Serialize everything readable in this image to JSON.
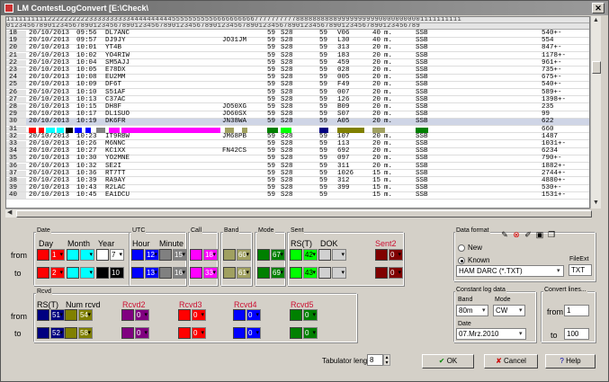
{
  "window": {
    "title": "LM ContestLogConvert [E:\\Check\\"
  },
  "grid": {
    "header_top": "11111111112222222222333333333344444444445555555555666666666677777777778888888888999999999900000000001111111111",
    "header_bottom": "0123456789012345678901234567890123456789012345678901234567890123456789012345678901234567890123456789",
    "rows": [
      {
        "n": "18",
        "date": "20/10/2013",
        "time": "09:56",
        "call": "DL7ANC",
        "loc": "",
        "rst": "59",
        "s": "S28",
        "rs": "59",
        "rn": "V06",
        "band": "40",
        "m": "m.",
        "mode": "SSB",
        "pts": "540+-"
      },
      {
        "n": "19",
        "date": "20/10/2013",
        "time": "09:57",
        "call": "DJ9JY",
        "loc": "JO31JM",
        "rst": "59",
        "s": "S28",
        "rs": "59",
        "rn": "L30",
        "band": "40",
        "m": "m.",
        "mode": "SSB",
        "pts": "554"
      },
      {
        "n": "20",
        "date": "20/10/2013",
        "time": "10:01",
        "call": "YT4B",
        "loc": "",
        "rst": "59",
        "s": "S28",
        "rs": "59",
        "rn": "313",
        "band": "20",
        "m": "m.",
        "mode": "SSB",
        "pts": "847+-"
      },
      {
        "n": "21",
        "date": "20/10/2013",
        "time": "10:02",
        "call": "YO4RIW",
        "loc": "",
        "rst": "59",
        "s": "S28",
        "rs": "59",
        "rn": "183",
        "band": "20",
        "m": "m.",
        "mode": "SSB",
        "pts": "1178+-"
      },
      {
        "n": "22",
        "date": "20/10/2013",
        "time": "10:04",
        "call": "SM5AJJ",
        "loc": "",
        "rst": "59",
        "s": "S28",
        "rs": "59",
        "rn": "459",
        "band": "20",
        "m": "m.",
        "mode": "SSB",
        "pts": "961+-"
      },
      {
        "n": "23",
        "date": "20/10/2013",
        "time": "10:05",
        "call": "E78DX",
        "loc": "",
        "rst": "59",
        "s": "S28",
        "rs": "59",
        "rn": "028",
        "band": "20",
        "m": "m.",
        "mode": "SSB",
        "pts": "735+-"
      },
      {
        "n": "24",
        "date": "20/10/2013",
        "time": "10:08",
        "call": "EU2MM",
        "loc": "",
        "rst": "59",
        "s": "S28",
        "rs": "59",
        "rn": "005",
        "band": "20",
        "m": "m.",
        "mode": "SSB",
        "pts": "675+-"
      },
      {
        "n": "25",
        "date": "20/10/2013",
        "time": "10:09",
        "call": "DF6T",
        "loc": "",
        "rst": "59",
        "s": "S28",
        "rs": "59",
        "rn": "F49",
        "band": "20",
        "m": "m.",
        "mode": "SSB",
        "pts": "540+-"
      },
      {
        "n": "26",
        "date": "20/10/2013",
        "time": "10:10",
        "call": "S51AF",
        "loc": "",
        "rst": "59",
        "s": "S28",
        "rs": "59",
        "rn": "007",
        "band": "20",
        "m": "m.",
        "mode": "SSB",
        "pts": "589+-"
      },
      {
        "n": "27",
        "date": "20/10/2013",
        "time": "10:13",
        "call": "C37AC",
        "loc": "",
        "rst": "59",
        "s": "S28",
        "rs": "59",
        "rn": "126",
        "band": "20",
        "m": "m.",
        "mode": "SSB",
        "pts": "1398+-"
      },
      {
        "n": "28",
        "date": "20/10/2013",
        "time": "10:15",
        "call": "DH8F",
        "loc": "JO50XG",
        "rst": "59",
        "s": "S28",
        "rs": "59",
        "rn": "B09",
        "band": "20",
        "m": "m.",
        "mode": "SSB",
        "pts": "235"
      },
      {
        "n": "29",
        "date": "20/10/2013",
        "time": "10:17",
        "call": "DL1SUO",
        "loc": "JO60SX",
        "rst": "59",
        "s": "S28",
        "rs": "59",
        "rn": "S07",
        "band": "20",
        "m": "m.",
        "mode": "SSB",
        "pts": "99"
      },
      {
        "n": "30",
        "date": "20/10/2013",
        "time": "10:19",
        "call": "DK6FR",
        "loc": "JN38WA",
        "rst": "59",
        "s": "S28",
        "rs": "59",
        "rn": "A05",
        "band": "20",
        "m": "m.",
        "mode": "SSB",
        "pts": "622"
      },
      {
        "n": "31",
        "date": "",
        "time": "",
        "call": "",
        "loc": "",
        "rst": "",
        "s": "",
        "rs": "",
        "rn": "",
        "band": "",
        "m": "",
        "mode": "",
        "pts": "660"
      },
      {
        "n": "32",
        "date": "20/10/2013",
        "time": "10:23",
        "call": "IT9RBW",
        "loc": "JM68PB",
        "rst": "59",
        "s": "S28",
        "rs": "59",
        "rn": "107",
        "band": "20",
        "m": "m.",
        "mode": "SSB",
        "pts": "1487"
      },
      {
        "n": "33",
        "date": "20/10/2013",
        "time": "10:26",
        "call": "M6NNC",
        "loc": "",
        "rst": "59",
        "s": "S28",
        "rs": "59",
        "rn": "113",
        "band": "20",
        "m": "m.",
        "mode": "SSB",
        "pts": "1031+-"
      },
      {
        "n": "34",
        "date": "20/10/2013",
        "time": "10:27",
        "call": "KC1XX",
        "loc": "FN42CS",
        "rst": "59",
        "s": "S28",
        "rs": "59",
        "rn": "692",
        "band": "20",
        "m": "m.",
        "mode": "SSB",
        "pts": "6234"
      },
      {
        "n": "35",
        "date": "20/10/2013",
        "time": "10:30",
        "call": "YO2MNE",
        "loc": "",
        "rst": "59",
        "s": "S28",
        "rs": "59",
        "rn": "097",
        "band": "20",
        "m": "m.",
        "mode": "SSB",
        "pts": "790+-"
      },
      {
        "n": "36",
        "date": "20/10/2013",
        "time": "10:32",
        "call": "SE2I",
        "loc": "",
        "rst": "59",
        "s": "S28",
        "rs": "59",
        "rn": "311",
        "band": "20",
        "m": "m.",
        "mode": "SSB",
        "pts": "1882+-"
      },
      {
        "n": "37",
        "date": "20/10/2013",
        "time": "10:36",
        "call": "RT7TT",
        "loc": "",
        "rst": "59",
        "s": "S28",
        "rs": "59",
        "rn": "1026",
        "band": "15",
        "m": "m.",
        "mode": "SSB",
        "pts": "2744+-"
      },
      {
        "n": "38",
        "date": "20/10/2013",
        "time": "10:39",
        "call": "RA9AY",
        "loc": "",
        "rst": "59",
        "s": "S28",
        "rs": "59",
        "rn": "312",
        "band": "15",
        "m": "m.",
        "mode": "SSB",
        "pts": "4880+-"
      },
      {
        "n": "39",
        "date": "20/10/2013",
        "time": "10:43",
        "call": "R2LAC",
        "loc": "",
        "rst": "59",
        "s": "S28",
        "rs": "59",
        "rn": "399",
        "band": "15",
        "m": "m.",
        "mode": "SSB",
        "pts": "530+-"
      },
      {
        "n": "40",
        "date": "20/10/2013",
        "time": "10:45",
        "call": "EA1DCU",
        "loc": "",
        "rst": "59",
        "s": "S28",
        "rs": "59",
        "rn": "",
        "band": "15",
        "m": "m.",
        "mode": "SSB",
        "pts": "1531+-"
      }
    ]
  },
  "sections": {
    "from": "from",
    "to": "to",
    "date": {
      "label": "Date",
      "day": "Day",
      "month": "Month",
      "year": "Year",
      "from": [
        {
          "v": "1",
          "c": "#ff0000"
        },
        {
          "v": "",
          "c": "#00ffff"
        },
        {
          "v": "7",
          "c": "#ffffff"
        }
      ],
      "to": [
        {
          "v": "2",
          "c": "#ff0000"
        },
        {
          "v": "",
          "c": "#00ffff"
        },
        {
          "v": "10",
          "c": "#000000"
        }
      ]
    },
    "utc": {
      "label": "UTC",
      "hour": "Hour",
      "minute": "Minute",
      "from": [
        {
          "v": "12",
          "c": "#0000ff"
        },
        {
          "v": "15",
          "c": "#808080"
        }
      ],
      "to": [
        {
          "v": "13",
          "c": "#0000ff"
        },
        {
          "v": "16",
          "c": "#808080"
        }
      ]
    },
    "call": {
      "label": "Call",
      "from": {
        "v": "18",
        "c": "#ff00ff"
      },
      "to": {
        "v": "33",
        "c": "#ff00ff"
      }
    },
    "band": {
      "label": "Band",
      "from": {
        "v": "60",
        "c": "#a0a060"
      },
      "to": {
        "v": "61",
        "c": "#a0a060"
      }
    },
    "mode": {
      "label": "Mode",
      "from": {
        "v": "67",
        "c": "#008000"
      },
      "to": {
        "v": "69",
        "c": "#008000"
      }
    },
    "sent": {
      "label": "Sent",
      "rst": "RS(T)",
      "dok": "DOK",
      "sent2": "Sent2",
      "from": [
        {
          "v": "42",
          "c": "#00ff00"
        },
        {
          "v": "",
          "c": "#d0d0d0"
        },
        {
          "v": "0",
          "c": "#800000"
        }
      ],
      "to": [
        {
          "v": "43",
          "c": "#00ff00"
        },
        {
          "v": "",
          "c": "#d0d0d0"
        },
        {
          "v": "0",
          "c": "#800000"
        }
      ]
    },
    "rcvd": {
      "label": "Rcvd",
      "rst": "RS(T)",
      "num": "Num rcvd",
      "r2": "Rcvd2",
      "r3": "Rcvd3",
      "r4": "Rcvd4",
      "r5": "Rcvd5",
      "from": [
        {
          "v": "51",
          "c": "#000080"
        },
        {
          "v": "54",
          "c": "#808000"
        },
        {
          "v": "0",
          "c": "#800080"
        },
        {
          "v": "0",
          "c": "#ff0000"
        },
        {
          "v": "0",
          "c": "#0000ff"
        },
        {
          "v": "0",
          "c": "#008000"
        }
      ],
      "to": [
        {
          "v": "52",
          "c": "#000080"
        },
        {
          "v": "58",
          "c": "#808000"
        },
        {
          "v": "0",
          "c": "#800080"
        },
        {
          "v": "0",
          "c": "#ff0000"
        },
        {
          "v": "0",
          "c": "#0000ff"
        },
        {
          "v": "0",
          "c": "#008000"
        }
      ]
    },
    "tab": {
      "label": "Tabulator length",
      "value": "8"
    }
  },
  "dataformat": {
    "label": "Data format",
    "new": "New",
    "known": "Known",
    "select": "HAM DARC (*.TXT)",
    "fileext_label": "FileExt",
    "fileext": "TXT"
  },
  "constant": {
    "label": "Constant log data",
    "band_label": "Band",
    "band": "80m",
    "mode_label": "Mode",
    "mode": "CW",
    "date_label": "Date",
    "date": "07.Mrz.2010"
  },
  "convert": {
    "label": "Convert lines...",
    "from_label": "from",
    "from": "1",
    "to_label": "to",
    "to": "100"
  },
  "buttons": {
    "ok": "OK",
    "cancel": "Cancel",
    "help": "Help"
  },
  "strip_colors": [
    "#ff0000",
    "#00ffff",
    "#000000",
    "#0000ff",
    "#808080",
    "#ff00ff",
    "#a0a060",
    "#008000",
    "#00ff00",
    "#000080",
    "#808000"
  ]
}
